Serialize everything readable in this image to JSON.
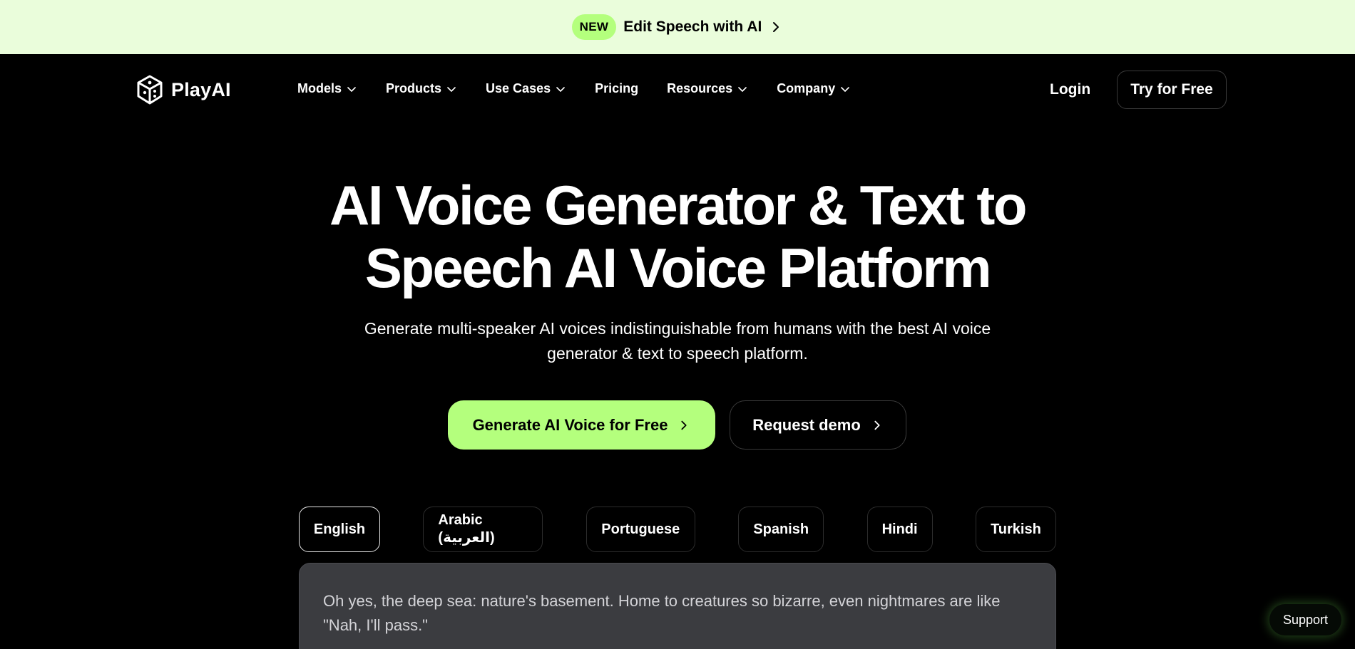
{
  "banner": {
    "badge": "NEW",
    "text": "Edit Speech with AI"
  },
  "nav": {
    "logo_text": "PlayAI",
    "items": [
      {
        "label": "Models",
        "has_dropdown": true
      },
      {
        "label": "Products",
        "has_dropdown": true
      },
      {
        "label": "Use Cases",
        "has_dropdown": true
      },
      {
        "label": "Pricing",
        "has_dropdown": false
      },
      {
        "label": "Resources",
        "has_dropdown": true
      },
      {
        "label": "Company",
        "has_dropdown": true
      }
    ],
    "login": "Login",
    "try_free": "Try for Free"
  },
  "hero": {
    "title_line1": "AI Voice Generator & Text to",
    "title_line2": "Speech AI Voice Platform",
    "subtitle_line1": "Generate multi-speaker AI voices indistinguishable from humans with the best AI voice",
    "subtitle_line2": "generator & text to speech platform.",
    "cta_primary": "Generate AI Voice for Free",
    "cta_secondary": "Request demo"
  },
  "languages": {
    "selected": "English",
    "tabs": [
      "English",
      "Arabic (العربية)",
      "Portuguese",
      "Spanish",
      "Hindi",
      "Turkish"
    ]
  },
  "sample": {
    "text_line1": "Oh yes, the deep sea: nature's basement. Home to creatures so bizarre, even nightmares are like",
    "text_line2": "\"Nah, I'll pass.\""
  },
  "support": {
    "label": "Support"
  },
  "colors": {
    "accent": "#b4ff7d",
    "banner_bg": "#eafddb",
    "panel_bg": "#3b3c40",
    "background": "#000000"
  }
}
